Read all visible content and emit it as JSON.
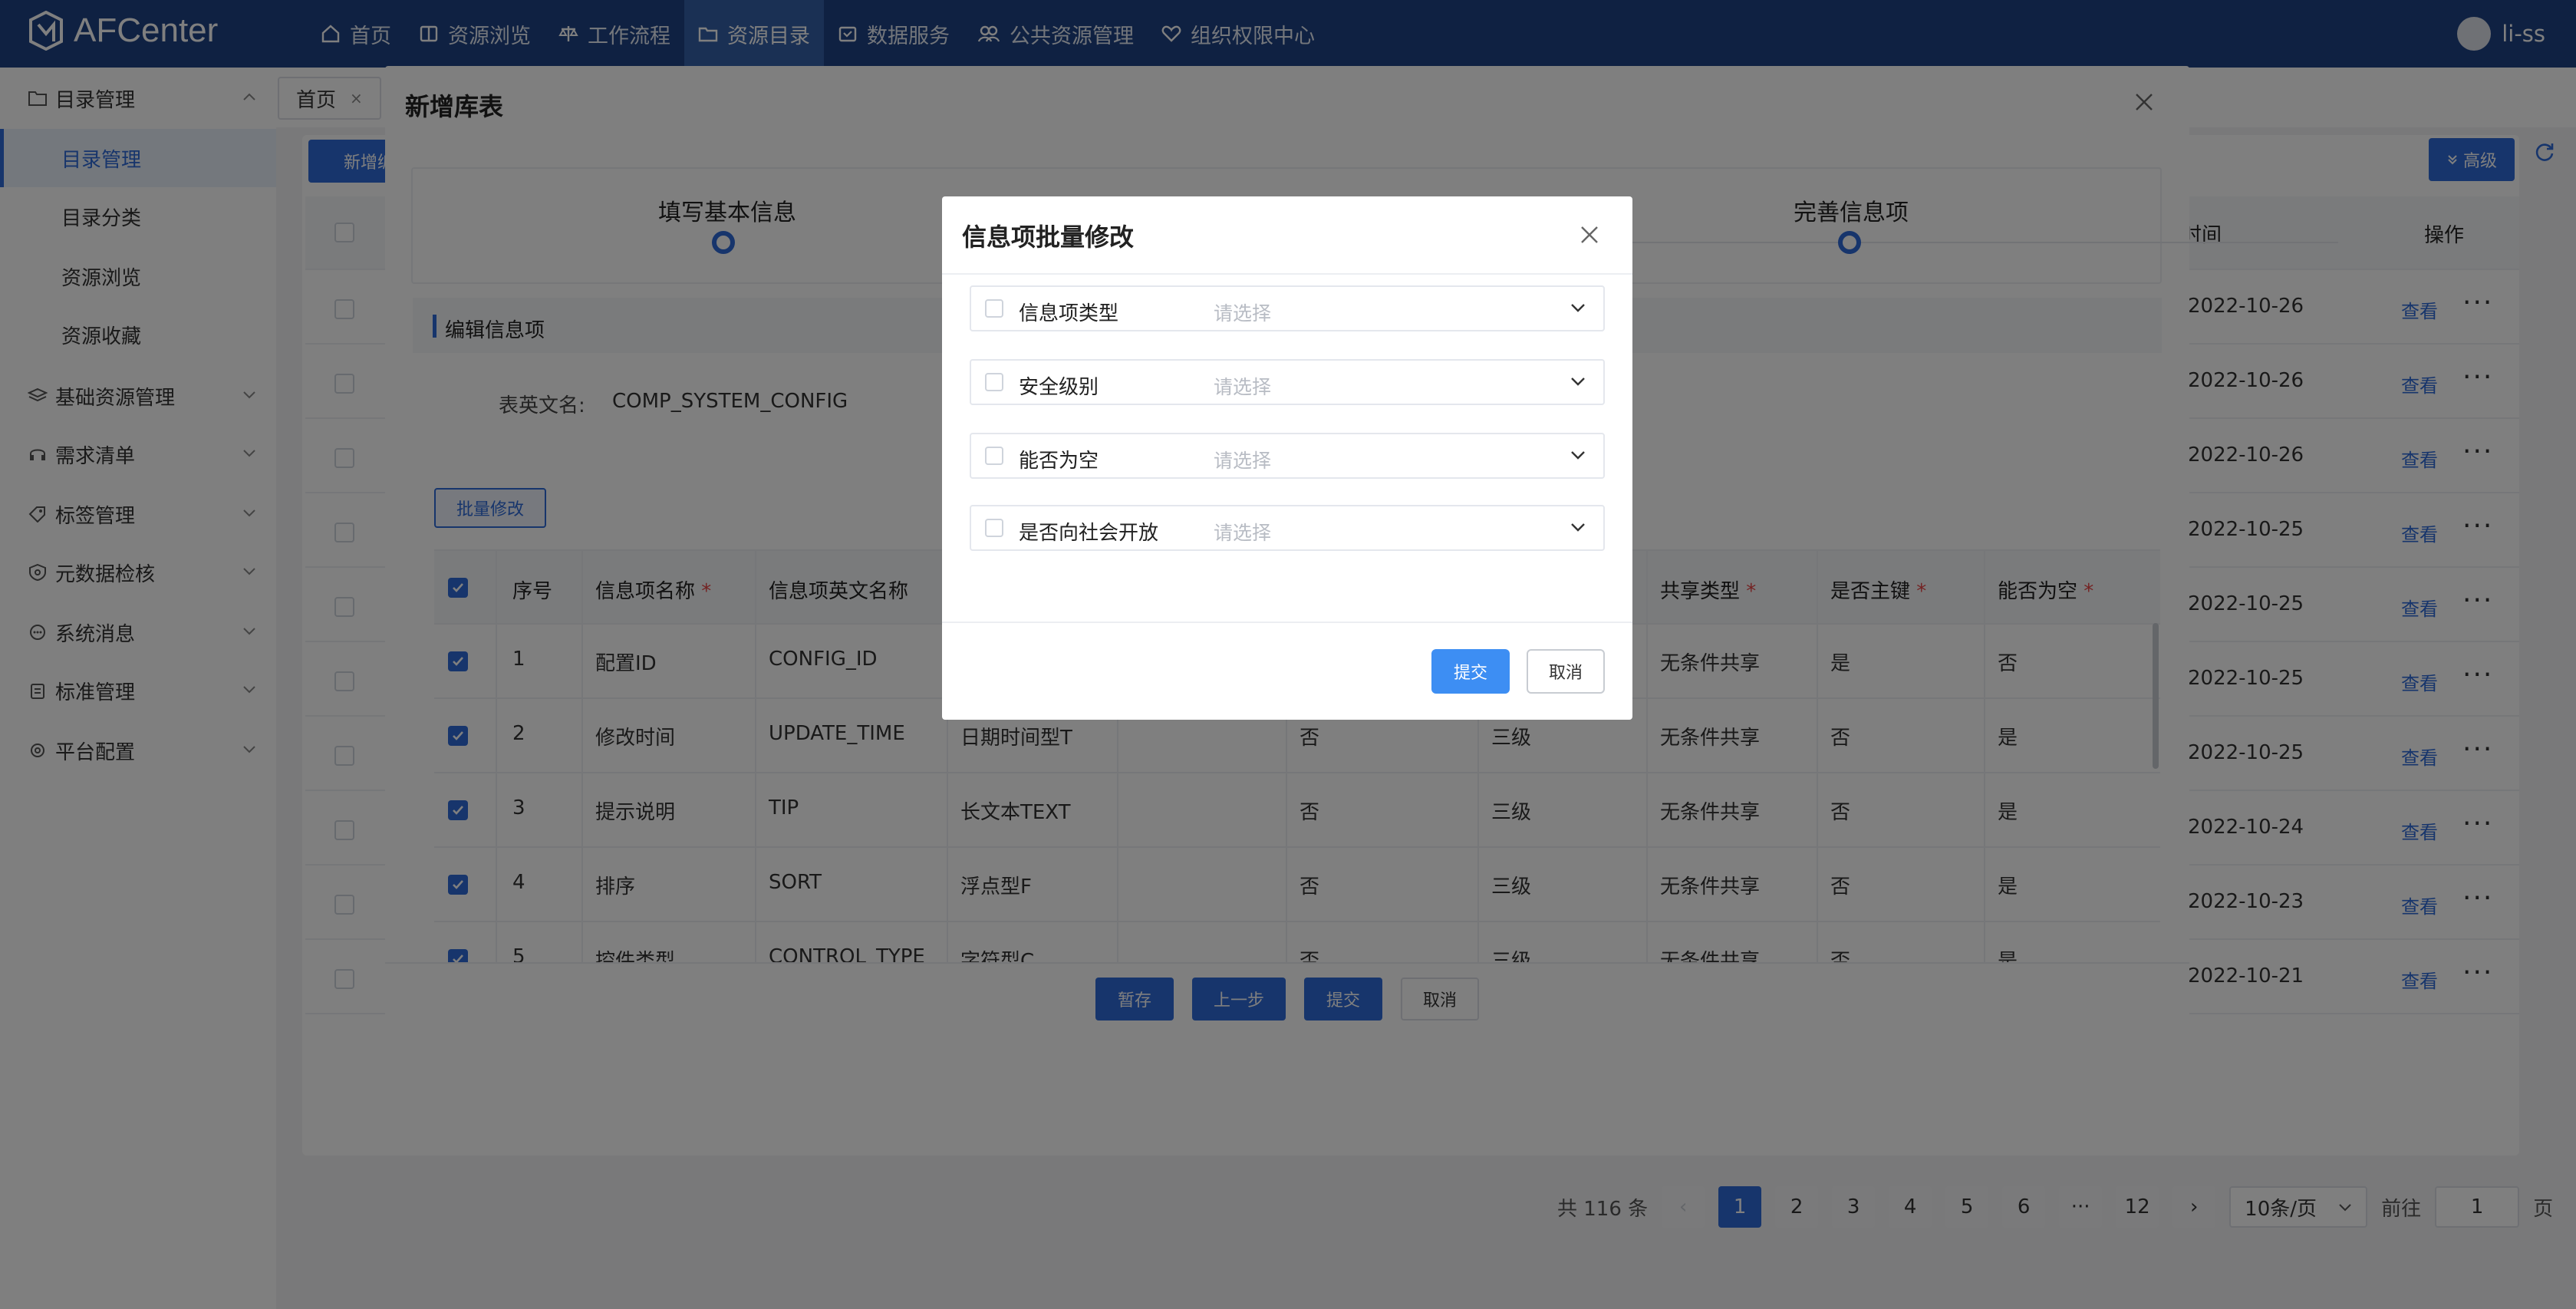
{
  "app": {
    "logo_text": "AFCenter",
    "user_name": "li-ss"
  },
  "topnav": {
    "items": [
      {
        "label": "首页",
        "icon": "home-icon"
      },
      {
        "label": "资源浏览",
        "icon": "book-icon"
      },
      {
        "label": "工作流程",
        "icon": "scale-icon"
      },
      {
        "label": "资源目录",
        "icon": "folder-icon",
        "active": true
      },
      {
        "label": "数据服务",
        "icon": "box-icon"
      },
      {
        "label": "公共资源管理",
        "icon": "users-icon"
      },
      {
        "label": "组织权限中心",
        "icon": "heart-icon"
      }
    ]
  },
  "sidebar": {
    "group_title": "目录管理",
    "sub_items": [
      "目录管理",
      "目录分类",
      "资源浏览",
      "资源收藏"
    ],
    "groups": [
      "基础资源管理",
      "需求清单",
      "标签管理",
      "元数据检核",
      "系统消息",
      "标准管理",
      "平台配置"
    ]
  },
  "tabs": {
    "home": "首页"
  },
  "background": {
    "new_button": "新增编目",
    "advanced_button": "高级",
    "time_header": "时间",
    "ops_header": "操作",
    "view_link": "查看",
    "more": "···",
    "dates": [
      "2022-10-26",
      "2022-10-26",
      "2022-10-26",
      "2022-10-25",
      "2022-10-25",
      "2022-10-25",
      "2022-10-25",
      "2022-10-24",
      "2022-10-23",
      "2022-10-21"
    ]
  },
  "pagination": {
    "total": "共 116 条",
    "pages": [
      "1",
      "2",
      "3",
      "4",
      "5",
      "6",
      "···",
      "12"
    ],
    "page_size": "10条/页",
    "goto_prefix": "前往",
    "goto_value": "1",
    "goto_suffix": "页"
  },
  "outer_dialog": {
    "title": "新增库表",
    "steps": [
      "填写基本信息",
      "完善信息项"
    ],
    "section_title": "编辑信息项",
    "field_label": "表英文名:",
    "field_value": "COMP_SYSTEM_CONFIG",
    "batch_button": "批量修改",
    "table": {
      "headers": [
        {
          "label": "序号",
          "required": false
        },
        {
          "label": "信息项名称",
          "required": true
        },
        {
          "label": "信息项英文名称",
          "required": false
        },
        {
          "label": "共享类型",
          "required": true
        },
        {
          "label": "是否主键",
          "required": true
        },
        {
          "label": "能否为空",
          "required": true
        }
      ],
      "required_mark": "*",
      "rows": [
        {
          "no": "1",
          "name": "配置ID",
          "en": "CONFIG_ID",
          "type": "",
          "nullable_flag": "",
          "level": "",
          "share": "无条件共享",
          "pk": "是",
          "null": "否"
        },
        {
          "no": "2",
          "name": "修改时间",
          "en": "UPDATE_TIME",
          "type": "日期时间型T",
          "nullable_flag": "否",
          "level": "三级",
          "share": "无条件共享",
          "pk": "否",
          "null": "是"
        },
        {
          "no": "3",
          "name": "提示说明",
          "en": "TIP",
          "type": "长文本TEXT",
          "nullable_flag": "否",
          "level": "三级",
          "share": "无条件共享",
          "pk": "否",
          "null": "是"
        },
        {
          "no": "4",
          "name": "排序",
          "en": "SORT",
          "type": "浮点型F",
          "nullable_flag": "否",
          "level": "三级",
          "share": "无条件共享",
          "pk": "否",
          "null": "是"
        },
        {
          "no": "5",
          "name": "控件类型",
          "en": "CONTROL_TYPE",
          "type": "字符型C",
          "nullable_flag": "否",
          "level": "三级",
          "share": "无条件共享",
          "pk": "否",
          "null": "是"
        }
      ]
    },
    "footer": {
      "save": "暂存",
      "prev": "上一步",
      "submit": "提交",
      "cancel": "取消"
    }
  },
  "modal": {
    "title": "信息项批量修改",
    "fields": [
      {
        "label": "信息项类型",
        "placeholder": "请选择"
      },
      {
        "label": "安全级别",
        "placeholder": "请选择"
      },
      {
        "label": "能否为空",
        "placeholder": "请选择"
      },
      {
        "label": "是否向社会开放",
        "placeholder": "请选择"
      }
    ],
    "submit": "提交",
    "cancel": "取消"
  },
  "colors": {
    "nav": "#1f4285",
    "primary": "#2f6bd8",
    "required": "#e84747"
  }
}
